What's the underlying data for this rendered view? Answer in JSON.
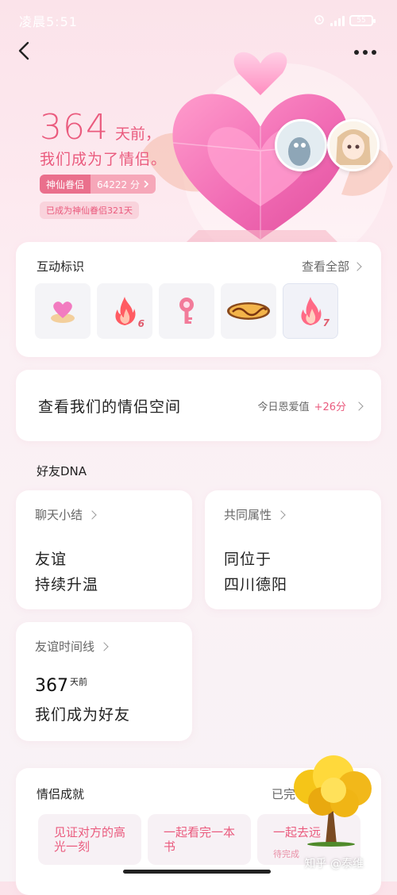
{
  "status_bar": {
    "time": "凌晨5:51",
    "battery": "55"
  },
  "hero": {
    "days": "364",
    "days_suffix": "天前，",
    "became": "我们成为了情侣。",
    "level_name": "神仙眷侣",
    "level_score": "64222 分",
    "level_days": "已成为神仙眷侣321天"
  },
  "interaction": {
    "title": "互动标识",
    "view_all": "查看全部",
    "badges": [
      {
        "icon": "heart-crown-icon",
        "count": ""
      },
      {
        "icon": "flame-icon",
        "count": "6"
      },
      {
        "icon": "key-icon",
        "count": ""
      },
      {
        "icon": "logo-badge-icon",
        "count": ""
      },
      {
        "icon": "flame-icon",
        "count": "7"
      }
    ]
  },
  "couple_space": {
    "title": "查看我们的情侣空间",
    "today_label": "今日恩爱值",
    "today_value": "+26分"
  },
  "dna": {
    "section_title": "好友DNA",
    "chat_summary": {
      "label": "聊天小结",
      "line1": "友谊",
      "line2": "持续升温"
    },
    "common": {
      "label": "共同属性",
      "line1": "同位于",
      "line2": "四川德阳"
    },
    "timeline": {
      "label": "友谊时间线",
      "days": "367",
      "days_suffix": "天前",
      "line": "我们成为好友"
    }
  },
  "achievements": {
    "title": "情侣成就",
    "right_text": "已完",
    "items": [
      {
        "title": "见证对方的高光一刻",
        "status": ""
      },
      {
        "title": "一起看完一本书",
        "status": ""
      },
      {
        "title": "一起去远",
        "status": "待完成"
      }
    ]
  },
  "watermark": "知乎 @泰维",
  "colors": {
    "accent": "#ea5b7e",
    "pill_dark": "#ea6f8c",
    "pill_light": "#f6a7b9"
  }
}
